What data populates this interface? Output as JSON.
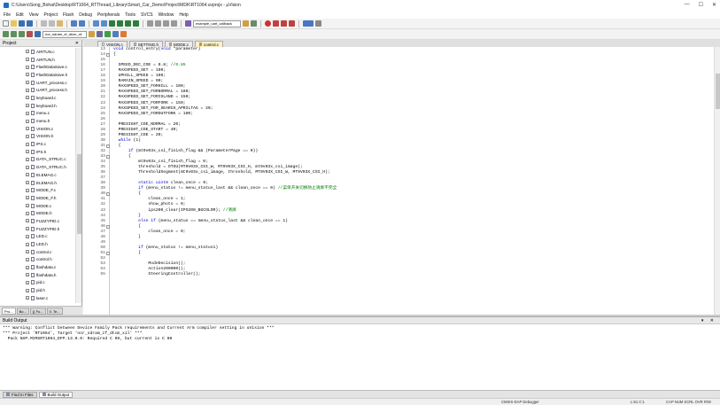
{
  "window": {
    "title": "C:\\Users\\Song_Bohai\\Desktop\\RT1064_RTThread_Library\\Smart_Car_Demo\\Project\\MDK\\RT1064.uvprojx - µVision",
    "minimize": "—",
    "maximize": "☐",
    "close": "✕"
  },
  "menu": [
    "File",
    "Edit",
    "View",
    "Project",
    "Flash",
    "Debug",
    "Peripherals",
    "Tools",
    "SVCS",
    "Window",
    "Help"
  ],
  "toolbar": {
    "target_combo": "example_uart_callback",
    "build_target": "nor_sdram_zf_dtcm_xil"
  },
  "project_panel": {
    "title": "Project",
    "close": "✕",
    "files": [
      "AIRTUN.c",
      "AIRTUN.h",
      "FlashDataSave.c",
      "FlashDataSave.h",
      "UART_process.c",
      "UART_process.h",
      "keyboard.c",
      "keyboard.h",
      "menu.c",
      "menu.h",
      "VISION.c",
      "VISION.h",
      "IPS.c",
      "IPS.h",
      "DATA_STRUC.c",
      "DATA_STRUC.h",
      "ELEMAG.c",
      "ELEMAG.h",
      "MODE_F.c",
      "MODE_F.h",
      "MODE.c",
      "MODE.h",
      "FUZZYPID.c",
      "FUZZYPID.h",
      "LED.c",
      "LED.h",
      "control.c",
      "control.h",
      "flashdata.c",
      "flashdata.h",
      "pid.c",
      "pid.h",
      "laser.c",
      "laser.h"
    ],
    "tabs": [
      "Pro...",
      "Bo...",
      "{} Fu...",
      "0. Te..."
    ]
  },
  "editor": {
    "tabs": [
      {
        "label": "VISION.c",
        "color": "#ffffff"
      },
      {
        "label": "SETTING.h",
        "color": "#f2c34a"
      },
      {
        "label": "MODE.c",
        "color": "#e2a84a"
      },
      {
        "label": "control.c",
        "color": "#e2884a"
      }
    ],
    "lines": [
      {
        "n": "13",
        "f": "",
        "t": "void control_entry(void *parameter)"
      },
      {
        "n": "14",
        "f": "-",
        "t": "{"
      },
      {
        "n": "15",
        "f": "",
        "t": ""
      },
      {
        "n": "16",
        "f": "",
        "t": "  SPEED_DEC_COE = 0.8; //0.85"
      },
      {
        "n": "17",
        "f": "",
        "t": "  MAXSPEED_SET = 190;"
      },
      {
        "n": "18",
        "f": "",
        "t": "  UPHILL_SPEED = 100;"
      },
      {
        "n": "19",
        "f": "",
        "t": "  RAMAIN_SPEED = 90;"
      },
      {
        "n": "20",
        "f": "",
        "t": "  MAXSPEED_SET_FORHILL = 100;"
      },
      {
        "n": "21",
        "f": "",
        "t": "  MAXSPEED_SET_FORNORMAL = 180;"
      },
      {
        "n": "22",
        "f": "",
        "t": "  MAXSPEED_SET_FORISLAND = 150;"
      },
      {
        "n": "23",
        "f": "",
        "t": "  MAXSPEED_SET_FORFORK = 150;"
      },
      {
        "n": "24",
        "f": "",
        "t": "  MAXSPEED_SET_FOR_SEARCH_APRILTAG = 20;"
      },
      {
        "n": "25",
        "f": "",
        "t": "  MAXSPEED_SET_FOROUTFORK = 100;"
      },
      {
        "n": "26",
        "f": "",
        "t": ""
      },
      {
        "n": "27",
        "f": "",
        "t": "  PRESIGHT_COE_NORMAL = 20;"
      },
      {
        "n": "28",
        "f": "",
        "t": "  PRESIGHT_COE_START = 40;"
      },
      {
        "n": "29",
        "f": "",
        "t": "  PRESIGHT_COE = 20;"
      },
      {
        "n": "30",
        "f": "",
        "t": "  while (1)"
      },
      {
        "n": "31",
        "f": "-",
        "t": "  {"
      },
      {
        "n": "32",
        "f": "",
        "t": "      if (mt9v03x_csi_finish_flag && (ParameterPage == 0))"
      },
      {
        "n": "33",
        "f": "-",
        "t": "      {"
      },
      {
        "n": "34",
        "f": "",
        "t": "          mt9v03x_csi_finish_flag = 0;"
      },
      {
        "n": "35",
        "f": "",
        "t": "          threshold = OTSU(MT9V03X_CSI_W, MT9V03X_CSI_H, mt9v03x_csi_image);"
      },
      {
        "n": "36",
        "f": "",
        "t": "          ThresholdSegment(mt9v03x_csi_image, threshold, MT9V03X_CSI_W, MT9V03X_CSI_H);"
      },
      {
        "n": "37",
        "f": "",
        "t": ""
      },
      {
        "n": "38",
        "f": "",
        "t": "          static uint8 clean_once = 0;"
      },
      {
        "n": "39",
        "f": "",
        "t": "          if (menu_status != menu_status_last && clean_once == 0) //菜单开关切换防止清屏不完全"
      },
      {
        "n": "40",
        "f": "-",
        "t": "          {"
      },
      {
        "n": "41",
        "f": "",
        "t": "              clean_once = 1;"
      },
      {
        "n": "42",
        "f": "",
        "t": "              show_photo = 0;"
      },
      {
        "n": "43",
        "f": "",
        "t": "              ips200_clear(IPS200_BGCOLOR); //清屏"
      },
      {
        "n": "44",
        "f": "",
        "t": "          }"
      },
      {
        "n": "45",
        "f": "",
        "t": "          else if (menu_status == menu_status_last && clean_once == 1)"
      },
      {
        "n": "46",
        "f": "-",
        "t": "          {"
      },
      {
        "n": "47",
        "f": "",
        "t": "              clean_once = 0;"
      },
      {
        "n": "48",
        "f": "",
        "t": "          }"
      },
      {
        "n": "49",
        "f": "",
        "t": ""
      },
      {
        "n": "50",
        "f": "",
        "t": "          if (menu_status != menu_status1)"
      },
      {
        "n": "51",
        "f": "-",
        "t": "          {"
      },
      {
        "n": "52",
        "f": "",
        "t": ""
      },
      {
        "n": "53",
        "f": "",
        "t": "              ModeDecision();"
      },
      {
        "n": "54",
        "f": "",
        "t": "              Action200000();"
      },
      {
        "n": "55",
        "f": "",
        "t": "              SteeringController();"
      }
    ]
  },
  "build_output": {
    "title": "Build Output",
    "controls": "▾ ✕",
    "lines": [
      "*** Warning: Conflict between Device Family Pack requirements and Current Arm compiler setting in uVision ***",
      "*** Project 'RT1064', Target 'nor_sdram_zf_dtcm_xil' ***",
      "  Pack NXP.MIMXRT1064_DFP.13.0.0: Required C 99, but current is C 90"
    ]
  },
  "bottom_tabs": [
    "Find In Files",
    "Build Output"
  ],
  "status": {
    "debugger": "CMSIS-DAP Debugger",
    "position": "L:51 C:1",
    "keys": "CAP  NUM  SCRL  OVR  R/W"
  },
  "colors": {
    "accent": "#1b6ec2",
    "active_tab": "#fdf0c4",
    "keyword": "#0000cc",
    "comment": "#008000"
  }
}
